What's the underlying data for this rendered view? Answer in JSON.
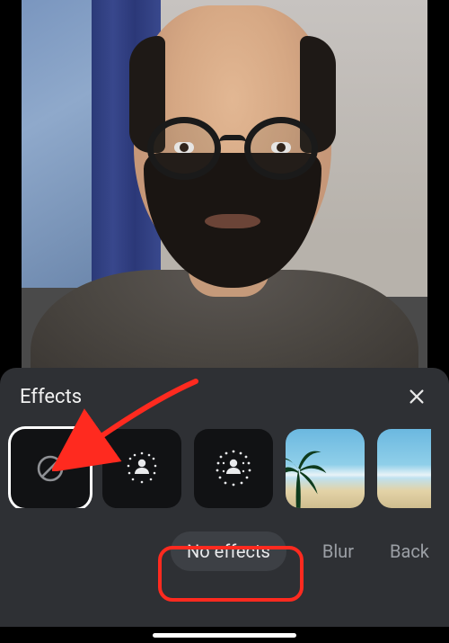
{
  "panel": {
    "title": "Effects",
    "close_icon": "close-icon"
  },
  "effects": {
    "tiles": [
      {
        "id": "none",
        "icon": "no-effect-icon",
        "selected": true
      },
      {
        "id": "blur-light",
        "icon": "blur-light-icon"
      },
      {
        "id": "blur-strong",
        "icon": "blur-strong-icon"
      },
      {
        "id": "bg-beach-1",
        "icon": "image-thumbnail"
      },
      {
        "id": "bg-beach-2",
        "icon": "image-thumbnail"
      }
    ],
    "labels": [
      {
        "label": "No effects",
        "active": true
      },
      {
        "label": "Blur",
        "active": false
      },
      {
        "label": "Back",
        "active": false
      }
    ]
  },
  "annotation": {
    "arrow_color": "#ff2a1f"
  }
}
